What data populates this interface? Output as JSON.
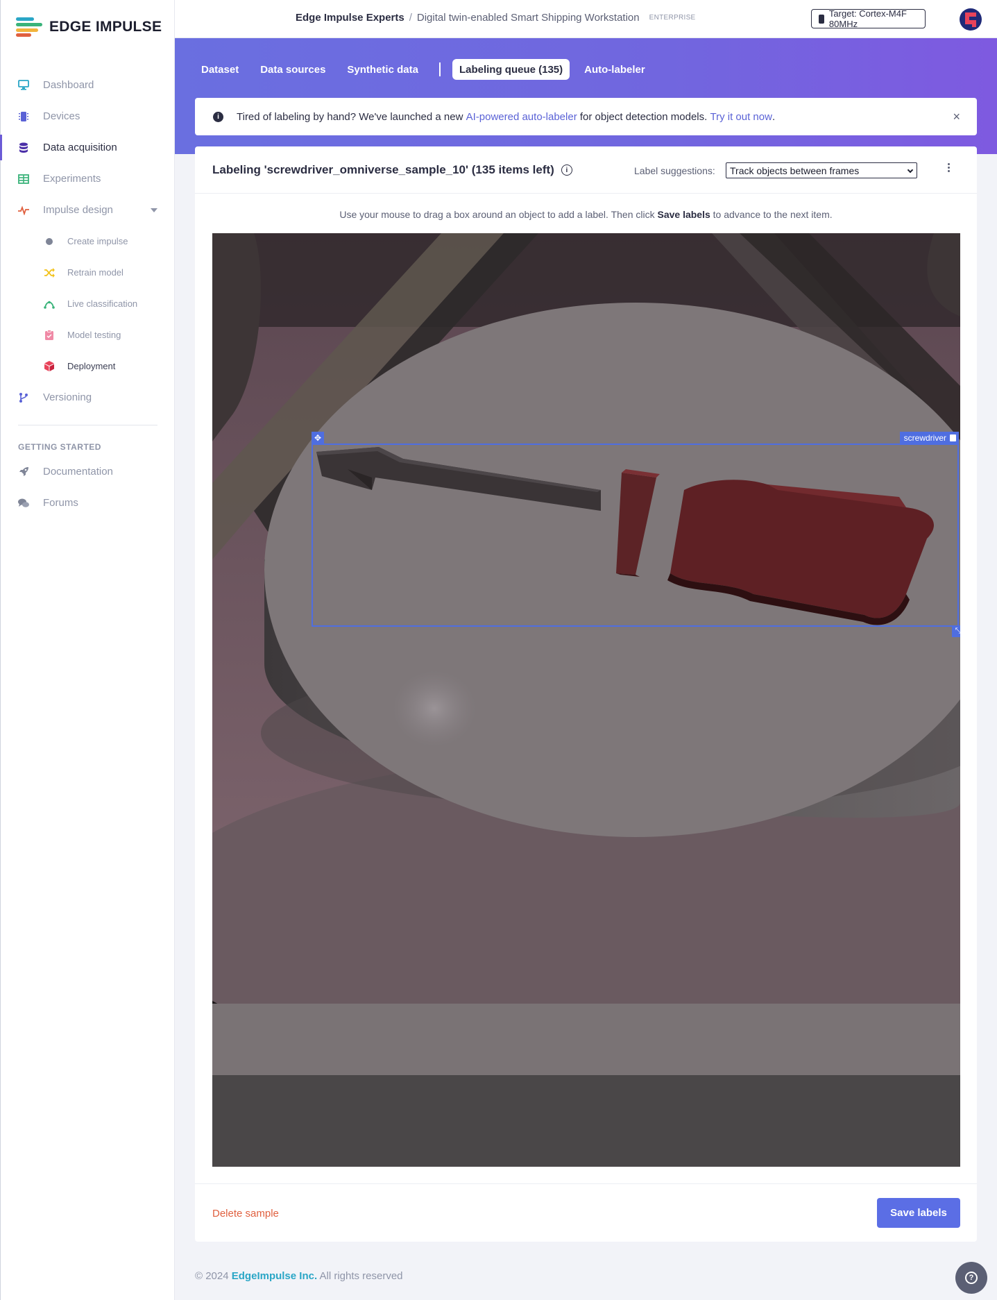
{
  "app": {
    "logo_text": "EDGE IMPULSE"
  },
  "sidebar": {
    "items": [
      {
        "label": "Dashboard",
        "icon": "monitor-icon"
      },
      {
        "label": "Devices",
        "icon": "chip-icon"
      },
      {
        "label": "Data acquisition",
        "icon": "database-icon",
        "active": true
      },
      {
        "label": "Experiments",
        "icon": "table-icon"
      },
      {
        "label": "Impulse design",
        "icon": "pulse-icon"
      }
    ],
    "sub_items": [
      {
        "label": "Create impulse",
        "icon": "dot-icon"
      },
      {
        "label": "Retrain model",
        "icon": "shuffle-icon"
      },
      {
        "label": "Live classification",
        "icon": "curve-icon"
      },
      {
        "label": "Model testing",
        "icon": "clipboard-check-icon"
      },
      {
        "label": "Deployment",
        "icon": "cube-icon"
      }
    ],
    "versioning": {
      "label": "Versioning",
      "icon": "branch-icon"
    },
    "section_title": "GETTING STARTED",
    "help_items": [
      {
        "label": "Documentation",
        "icon": "rocket-icon"
      },
      {
        "label": "Forums",
        "icon": "chat-icon"
      }
    ]
  },
  "header": {
    "org": "Edge Impulse Experts",
    "separator": "/",
    "project": "Digital twin-enabled Smart Shipping Workstation",
    "badge": "ENTERPRISE",
    "target": "Target: Cortex-M4F 80MHz"
  },
  "tabs": [
    {
      "label": "Dataset"
    },
    {
      "label": "Data sources"
    },
    {
      "label": "Synthetic data"
    },
    {
      "label": "Labeling queue (135)",
      "active": true
    },
    {
      "label": "Auto-labeler"
    }
  ],
  "notice": {
    "text_before": "Tired of labeling by hand? We've launched a new ",
    "link1": "AI-powered auto-labeler",
    "text_middle": " for object detection models. ",
    "link2": "Try it out now",
    "text_after": ".",
    "close": "×"
  },
  "labeling": {
    "title": "Labeling 'screwdriver_omniverse_sample_10' (135 items left)",
    "suggestions_label": "Label suggestions:",
    "suggestions_value": "Track objects between frames",
    "instructions_before": "Use your mouse to drag a box around an object to add a label. Then click ",
    "instructions_bold": "Save labels",
    "instructions_after": " to advance to the next item.",
    "bbox_label": "screwdriver",
    "delete_label": "Delete sample",
    "save_label": "Save labels"
  },
  "footer": {
    "copyright": "© 2024",
    "company": "EdgeImpulse Inc.",
    "rights": "All rights reserved"
  },
  "colors": {
    "accent": "#5b6ee5",
    "band_start": "#6a6fe0",
    "band_end": "#7e5ae0",
    "bbox": "#4f6ee0",
    "danger": "#e0603f",
    "brand_teal": "#2aa6c6"
  }
}
